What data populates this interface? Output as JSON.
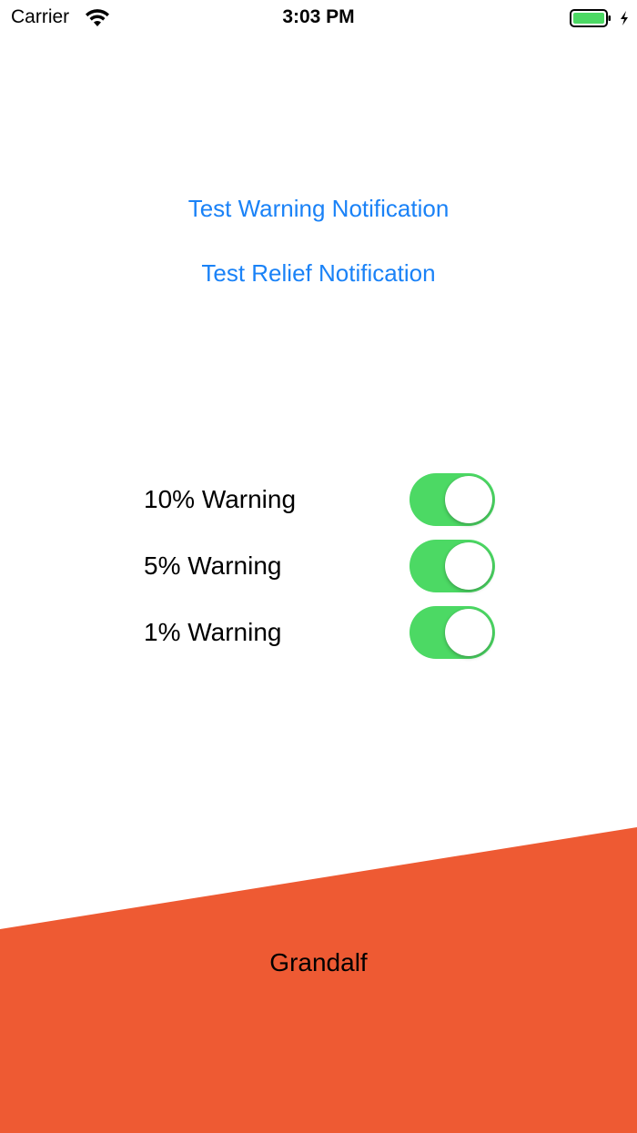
{
  "status_bar": {
    "carrier": "Carrier",
    "time": "3:03 PM",
    "wifi_icon": "wifi-icon",
    "battery_icon": "battery-full-icon",
    "charging_icon": "charging-bolt-icon",
    "battery_color": "#4cd964"
  },
  "actions": {
    "test_warning_label": "Test Warning Notification",
    "test_relief_label": "Test Relief Notification",
    "link_color": "#1a82f7"
  },
  "toggles": [
    {
      "label": "10% Warning",
      "on": true
    },
    {
      "label": "5% Warning",
      "on": true
    },
    {
      "label": "1% Warning",
      "on": true
    }
  ],
  "footer": {
    "title": "Grandalf",
    "color": "#ee5a33"
  }
}
